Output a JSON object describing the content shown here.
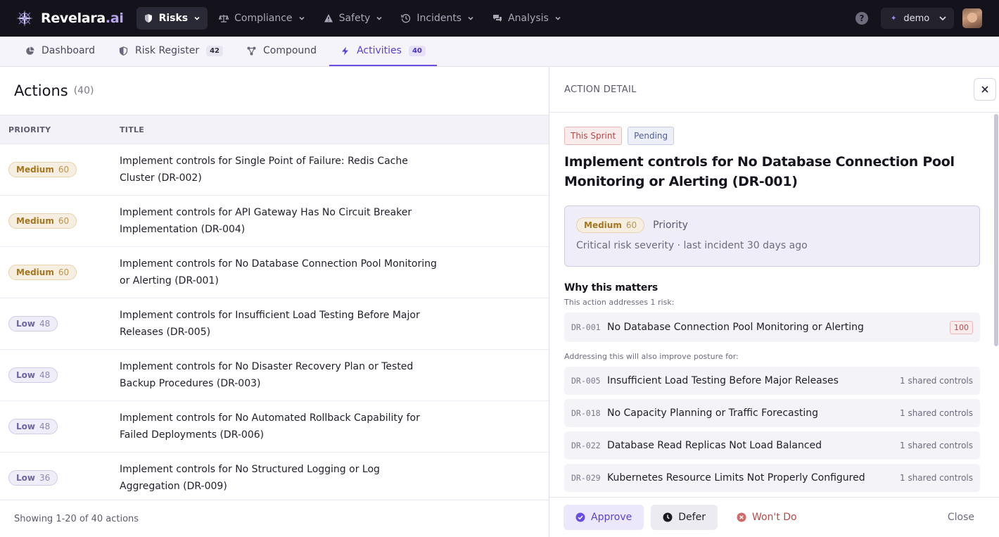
{
  "app": {
    "brand_name": "Revelara",
    "brand_suffix": ".ai"
  },
  "topnav": [
    {
      "label": "Risks",
      "icon": "shield-icon",
      "active": true
    },
    {
      "label": "Compliance",
      "icon": "scales-icon",
      "active": false
    },
    {
      "label": "Safety",
      "icon": "warning-icon",
      "active": false
    },
    {
      "label": "Incidents",
      "icon": "history-icon",
      "active": false
    },
    {
      "label": "Analysis",
      "icon": "chat-icon",
      "active": false
    }
  ],
  "topbar": {
    "help_label": "?",
    "tenant_label": "demo"
  },
  "subnav": [
    {
      "label": "Dashboard",
      "icon": "pie-chart-icon",
      "count": ""
    },
    {
      "label": "Risk Register",
      "icon": "shield-icon",
      "count": "42"
    },
    {
      "label": "Compound",
      "icon": "network-icon",
      "count": ""
    },
    {
      "label": "Activities",
      "icon": "bolt-icon",
      "count": "40",
      "active": true
    }
  ],
  "list": {
    "title": "Actions",
    "count": "(40)",
    "columns": {
      "priority": "PRIORITY",
      "title": "TITLE"
    },
    "rows": [
      {
        "level": "Medium",
        "score": "60",
        "title": "Implement controls for Single Point of Failure: Redis Cache Cluster (DR-002)"
      },
      {
        "level": "Medium",
        "score": "60",
        "title": "Implement controls for API Gateway Has No Circuit Breaker Implementation (DR-004)"
      },
      {
        "level": "Medium",
        "score": "60",
        "title": "Implement controls for No Database Connection Pool Monitoring or Alerting (DR-001)"
      },
      {
        "level": "Low",
        "score": "48",
        "title": "Implement controls for Insufficient Load Testing Before Major Releases (DR-005)"
      },
      {
        "level": "Low",
        "score": "48",
        "title": "Implement controls for No Disaster Recovery Plan or Tested Backup Procedures (DR-003)"
      },
      {
        "level": "Low",
        "score": "48",
        "title": "Implement controls for No Automated Rollback Capability for Failed Deployments (DR-006)"
      },
      {
        "level": "Low",
        "score": "36",
        "title": "Implement controls for No Structured Logging or Log Aggregation (DR-009)"
      }
    ],
    "footer": "Showing 1-20 of 40 actions"
  },
  "detail": {
    "header": "ACTION DETAIL",
    "tags": {
      "sprint": "This Sprint",
      "status": "Pending"
    },
    "title": "Implement controls for No Database Connection Pool Monitoring or Alerting (DR-001)",
    "priority": {
      "level": "Medium",
      "score": "60",
      "label": "Priority",
      "subtitle": "Critical risk severity · last incident 30 days ago"
    },
    "why_title": "Why this matters",
    "why_sub": "This action addresses 1 risk:",
    "primary_risk": {
      "code": "DR-001",
      "name": "No Database Connection Pool Monitoring or Alerting",
      "score": "100"
    },
    "also_label": "Addressing this will also improve posture for:",
    "related": [
      {
        "code": "DR-005",
        "name": "Insufficient Load Testing Before Major Releases",
        "shared": "1 shared controls"
      },
      {
        "code": "DR-018",
        "name": "No Capacity Planning or Traffic Forecasting",
        "shared": "1 shared controls"
      },
      {
        "code": "DR-022",
        "name": "Database Read Replicas Not Load Balanced",
        "shared": "1 shared controls"
      },
      {
        "code": "DR-029",
        "name": "Kubernetes Resource Limits Not Properly Configured",
        "shared": "1 shared controls"
      }
    ],
    "actions": {
      "approve": "Approve",
      "defer": "Defer",
      "wont": "Won't Do",
      "close": "Close"
    }
  }
}
